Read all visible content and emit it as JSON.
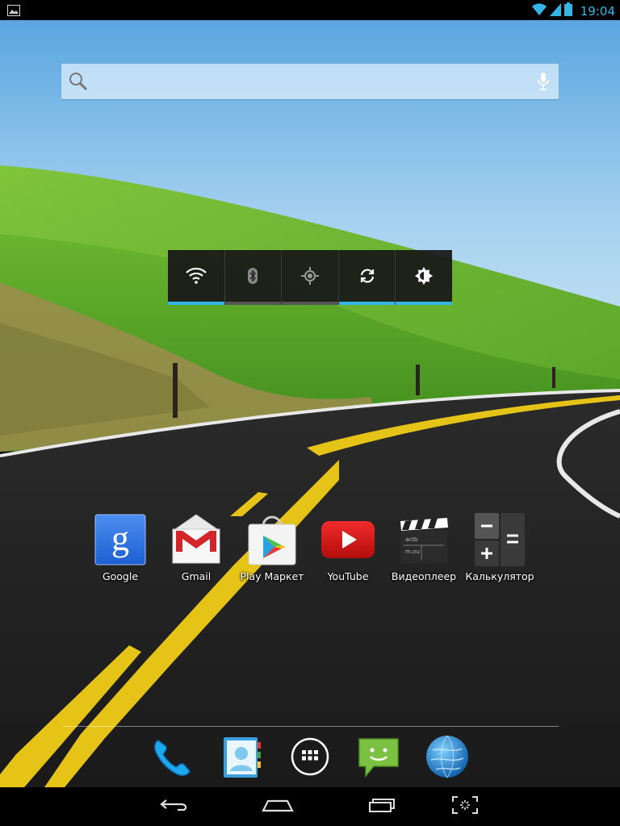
{
  "status_bar": {
    "time": "19:04",
    "icons": [
      "picture-notification-icon",
      "wifi-icon",
      "signal-icon",
      "battery-icon"
    ],
    "accent": "#33b5e5"
  },
  "search_widget": {
    "icons": [
      "search-icon",
      "mic-icon"
    ]
  },
  "power_control": {
    "toggles": [
      {
        "name": "wifi",
        "icon": "wifi-icon",
        "on": true
      },
      {
        "name": "bluetooth",
        "icon": "bluetooth-icon",
        "on": false
      },
      {
        "name": "gps",
        "icon": "gps-icon",
        "on": false
      },
      {
        "name": "sync",
        "icon": "sync-icon",
        "on": true
      },
      {
        "name": "brightness",
        "icon": "brightness-icon",
        "on": true
      }
    ]
  },
  "apps": [
    {
      "label": "Google",
      "icon": "google-search-icon"
    },
    {
      "label": "Gmail",
      "icon": "gmail-icon"
    },
    {
      "label": "Play Маркет",
      "icon": "play-store-icon"
    },
    {
      "label": "YouTube",
      "icon": "youtube-icon"
    },
    {
      "label": "Видеоплеер",
      "icon": "clapperboard-icon"
    },
    {
      "label": "Калькулятор",
      "icon": "calculator-icon"
    }
  ],
  "video_clapper_text": {
    "line1": "actb",
    "line2": "m.ou"
  },
  "dock": [
    {
      "icon": "phone-icon"
    },
    {
      "icon": "contacts-icon"
    },
    {
      "icon": "all-apps-icon"
    },
    {
      "icon": "messaging-icon"
    },
    {
      "icon": "browser-icon"
    }
  ],
  "nav_bar": {
    "buttons": [
      "back-icon",
      "home-icon",
      "recent-apps-icon",
      "screenshot-icon"
    ]
  }
}
